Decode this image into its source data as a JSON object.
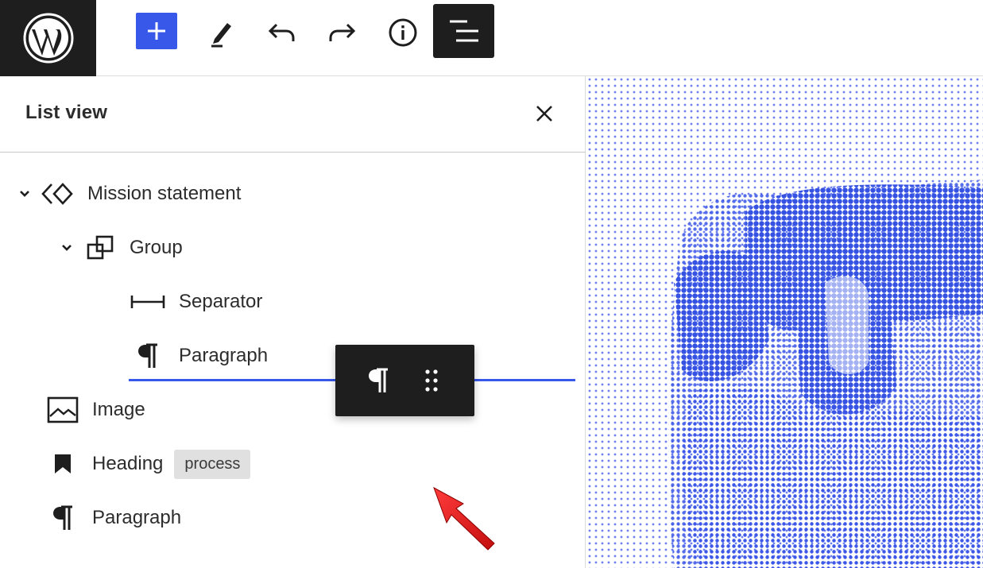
{
  "toolbar": {
    "logo_icon": "wordpress-logo-icon",
    "tools": [
      {
        "name": "add-block",
        "icon": "plus-icon"
      },
      {
        "name": "tools",
        "icon": "pen-icon"
      },
      {
        "name": "undo",
        "icon": "undo-icon"
      },
      {
        "name": "redo",
        "icon": "redo-icon"
      },
      {
        "name": "details",
        "icon": "info-icon"
      },
      {
        "name": "list-view",
        "icon": "list-view-icon",
        "active": true
      }
    ],
    "accent_color": "#3858e9"
  },
  "sidebar": {
    "title": "List view",
    "items": [
      {
        "label": "Mission statement",
        "icon": "reusable-block-icon",
        "expanded": true
      },
      {
        "label": "Group",
        "icon": "group-icon",
        "expanded": true
      },
      {
        "label": "Separator",
        "icon": "separator-icon"
      },
      {
        "label": "Paragraph",
        "icon": "paragraph-icon"
      },
      {
        "label": "Image",
        "icon": "image-icon"
      },
      {
        "label": "Heading",
        "icon": "bookmark-icon",
        "badge": "process"
      },
      {
        "label": "Paragraph",
        "icon": "paragraph-icon"
      }
    ]
  },
  "drag_chip": {
    "icon": "paragraph-icon",
    "handle_icon": "drag-handle-icon"
  },
  "colors": {
    "dark": "#1e1e1e",
    "drop_indicator": "#3858e9",
    "pointer": "#e01b1b",
    "halftone": "#3a55e6"
  }
}
